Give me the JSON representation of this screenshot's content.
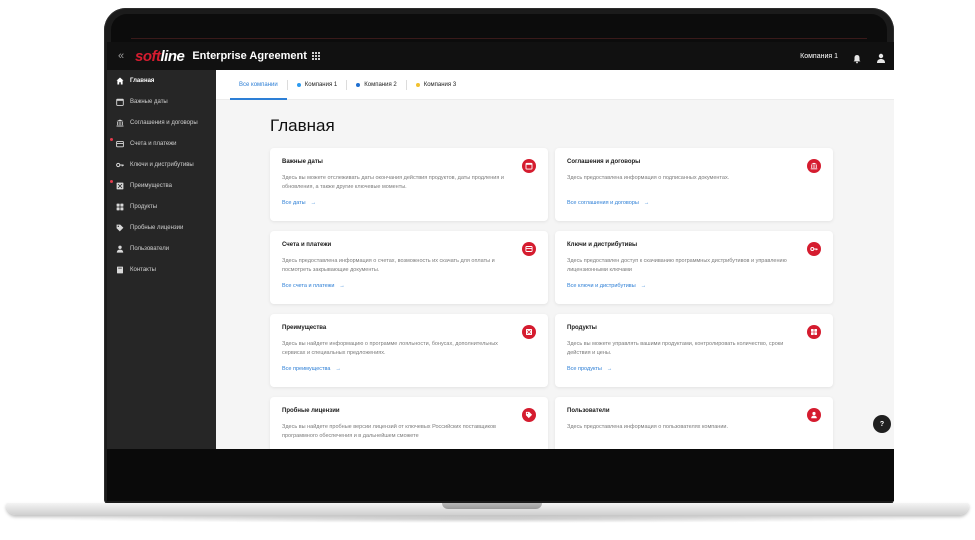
{
  "topbar": {
    "collapse_glyph": "«",
    "logo_soft": "soft",
    "logo_line": "line",
    "app_title": "Enterprise Agreement",
    "company_selector": "Компания 1"
  },
  "sidebar": {
    "items": [
      {
        "label": "Главная",
        "icon": "home-icon",
        "active": true
      },
      {
        "label": "Важные даты",
        "icon": "calendar-icon"
      },
      {
        "label": "Соглашения и договоры",
        "icon": "bank-icon"
      },
      {
        "label": "Счета и платежи",
        "icon": "wallet-icon",
        "badge": true
      },
      {
        "label": "Ключи и дистрибутивы",
        "icon": "key-icon"
      },
      {
        "label": "Преимущества",
        "icon": "gift-icon",
        "badge": true
      },
      {
        "label": "Продукты",
        "icon": "grid-icon"
      },
      {
        "label": "Пробные лицензии",
        "icon": "tag-icon"
      },
      {
        "label": "Пользователи",
        "icon": "user-icon"
      },
      {
        "label": "Контакты",
        "icon": "book-icon"
      }
    ]
  },
  "tabs": [
    {
      "label": "Все компании",
      "active": true
    },
    {
      "label": "Компания 1",
      "dot_color": "#2d9bf0"
    },
    {
      "label": "Компания 2",
      "dot_color": "#1f6fd1"
    },
    {
      "label": "Компания 3",
      "dot_color": "#f2c12e"
    }
  ],
  "main": {
    "page_title": "Главная"
  },
  "cards": [
    {
      "title": "Важные даты",
      "desc": "Здесь вы можете отслеживать даты окончания действия продуктов, даты продления и обновления, а также другие ключевые моменты.",
      "link": "Все даты",
      "icon": "calendar-icon"
    },
    {
      "title": "Соглашения и договоры",
      "desc": "Здесь предоставлена информация о подписанных документах.",
      "link": "Все соглашения и договоры",
      "icon": "bank-icon"
    },
    {
      "title": "Счета и платежи",
      "desc": "Здесь предоставлена информация о счетах, возможность их скачать для оплаты и посмотреть закрывающие документы.",
      "link": "Все счета и платежи",
      "icon": "wallet-icon"
    },
    {
      "title": "Ключи и дистрибутивы",
      "desc": "Здесь предоставлен доступ к скачиванию программных дистрибутивов и управлению лицензионными ключами",
      "link": "Все ключи и дистрибутивы",
      "icon": "key-icon"
    },
    {
      "title": "Преимущества",
      "desc": "Здесь вы найдете информацию о программе лояльности, бонусах, дополнительных сервисах и специальных предложениях.",
      "link": "Все преимущества",
      "icon": "gift-icon"
    },
    {
      "title": "Продукты",
      "desc": "Здесь вы можете управлять вашими продуктами, контролировать количество, сроки действия и цены.",
      "link": "Все продукты",
      "icon": "grid-icon"
    },
    {
      "title": "Пробные лицензии",
      "desc": "Здесь вы найдете пробные версии лицензий от ключевых Российских поставщиков программного обеспечения и в дальнейшем сможете",
      "link": "",
      "icon": "tag-icon"
    },
    {
      "title": "Пользователи",
      "desc": "Здесь предоставлена информация о пользователях компании.",
      "link": "",
      "icon": "user-icon"
    }
  ],
  "help": {
    "label": "?"
  },
  "colors": {
    "brand": "#d51c2f",
    "link": "#2d7fd6",
    "sidebar": "#262626",
    "topbar": "#111111"
  }
}
